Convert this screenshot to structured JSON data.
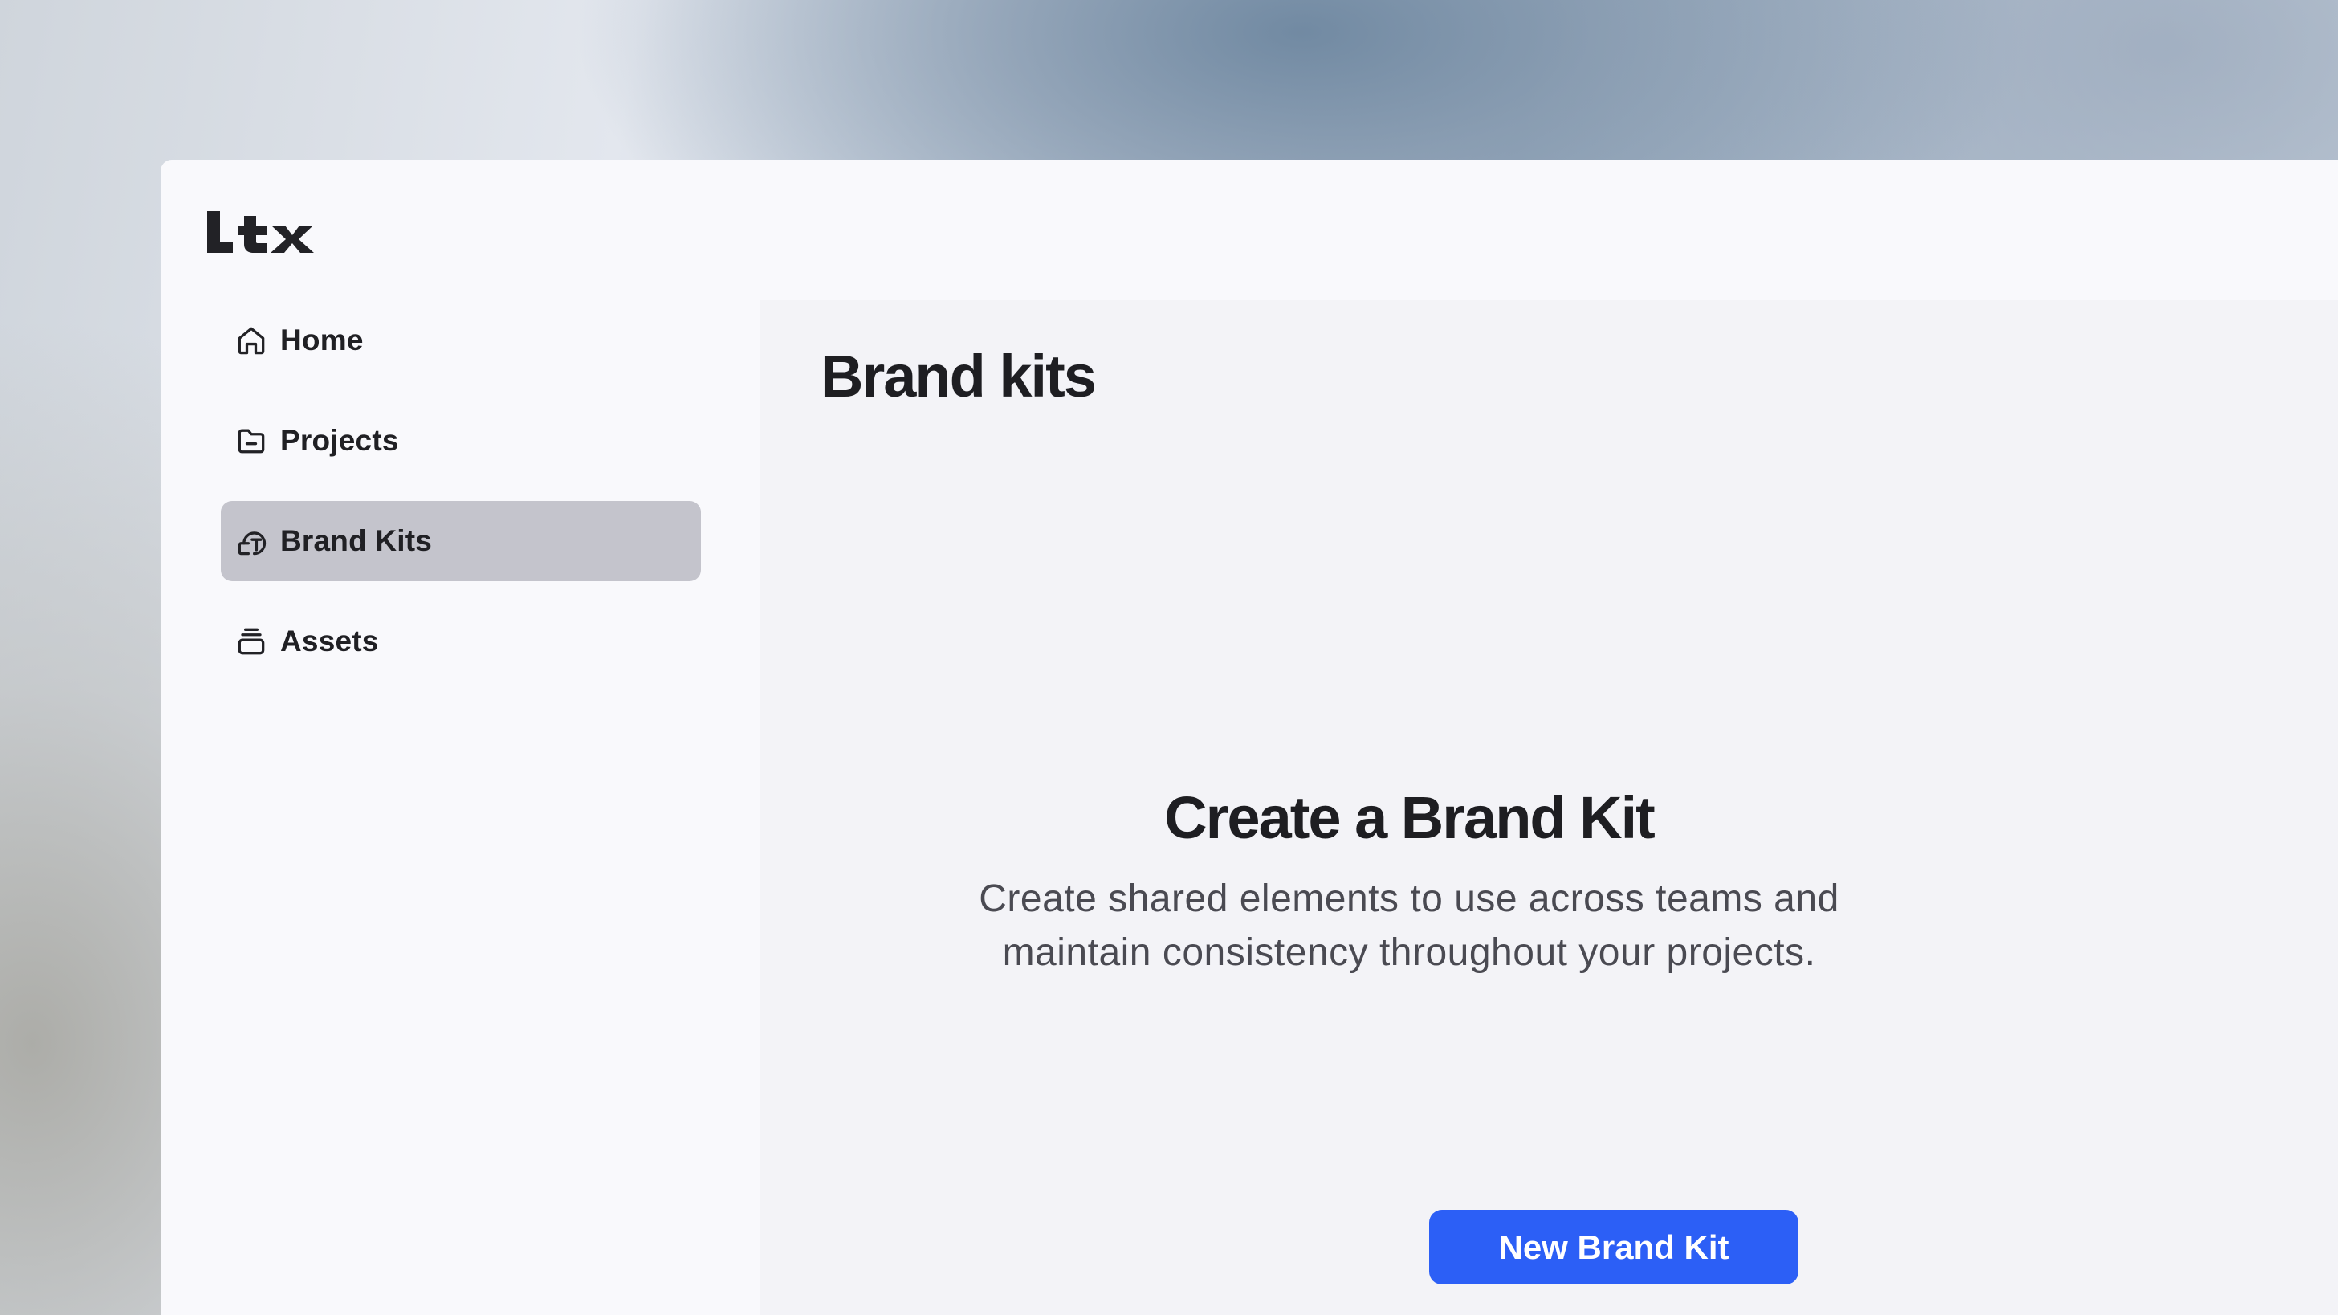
{
  "app": {
    "logo_text": "ltx"
  },
  "sidebar": {
    "items": [
      {
        "label": "Home",
        "icon": "home-icon",
        "active": false
      },
      {
        "label": "Projects",
        "icon": "folder-icon",
        "active": false
      },
      {
        "label": "Brand Kits",
        "icon": "brand-kit-icon",
        "active": true
      },
      {
        "label": "Assets",
        "icon": "stack-icon",
        "active": false
      }
    ]
  },
  "main": {
    "title": "Brand kits",
    "empty_state": {
      "title": "Create a Brand Kit",
      "description": "Create shared elements to use across teams and maintain consistency throughout your projects.",
      "button_label": "New Brand Kit"
    }
  },
  "colors": {
    "primary": "#2c5ff6",
    "active_nav_bg": "#c4c4cc",
    "text": "#1e1e22",
    "panel_bg": "#f9f9fc",
    "main_bg": "#f3f3f7"
  }
}
